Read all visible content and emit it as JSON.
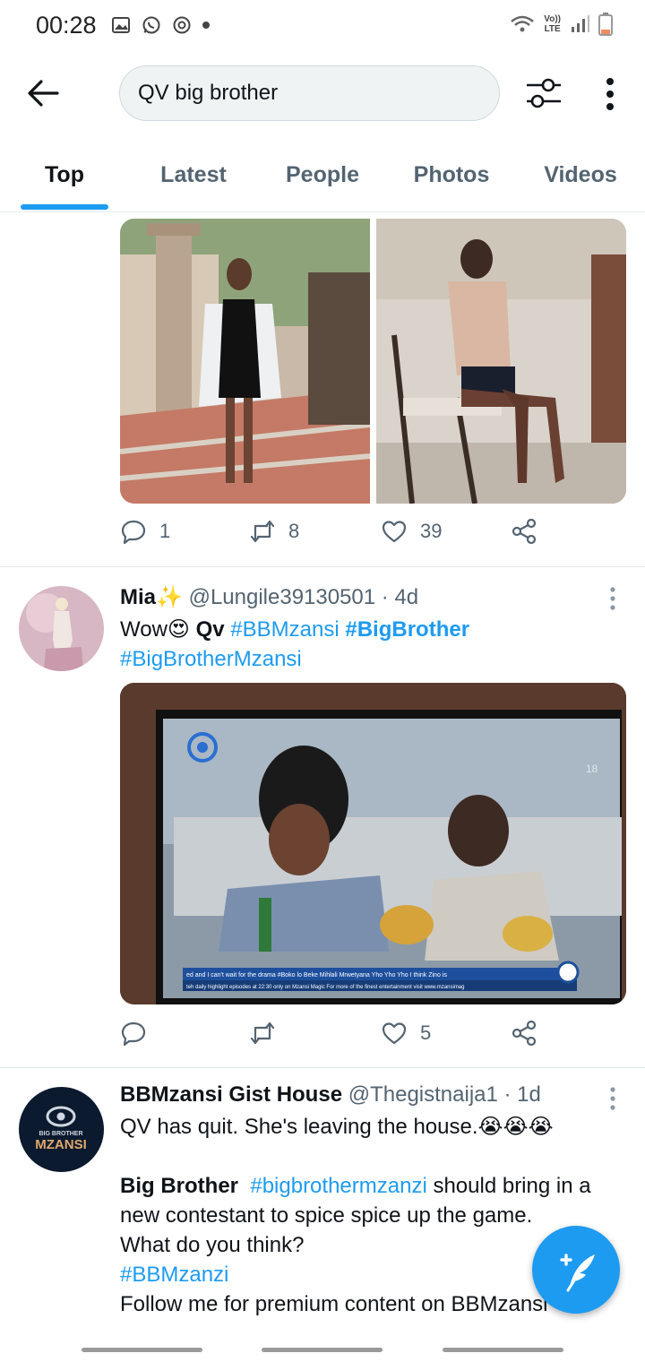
{
  "status_bar": {
    "time": "00:28",
    "net_line1": "Vo))",
    "net_line2": "LTE"
  },
  "search": {
    "query": "QV big brother"
  },
  "tabs": [
    {
      "label": "Top",
      "active": true
    },
    {
      "label": "Latest",
      "active": false
    },
    {
      "label": "People",
      "active": false
    },
    {
      "label": "Photos",
      "active": false
    },
    {
      "label": "Videos",
      "active": false
    }
  ],
  "tweet1": {
    "reply_count": "1",
    "retweet_count": "8",
    "like_count": "39"
  },
  "tweet2": {
    "name": "Mia",
    "handle": "@Lungile39130501",
    "time": "· 4d",
    "text_prefix": "Wow",
    "text_mid": " Qv ",
    "tag1": "#BBMzansi",
    "tag2": "#BigBrother",
    "tag3": "#BigBrotherMzansi",
    "reply_count": "",
    "retweet_count": "",
    "like_count": "5",
    "tv_ticker_line1": "ed and I can't wait for the drama #Boko lo Beke   Mihlali Mrwetyana  Yho Yho Yho I think Zino is",
    "tv_ticker_line2": "teh daily highlight episodes at 22:30 only on Mzansi Magic  For more of the finest entertainment visit www.mzansimag",
    "tv_channel": "18"
  },
  "tweet3": {
    "name": "BBMzansi Gist House",
    "handle": "@Thegistnaija1",
    "time": "· 1d",
    "line1": "QV has quit. She's leaving the house.",
    "line1_emoji": "😭😭😭",
    "para2_bold": "Big Brother",
    "para2_tag": "#bigbrothermzanzi",
    "para2_rest": " should bring in a",
    "line3": "new contestant to spice spice up the game.",
    "line4": "What do you think?",
    "line5": "#BBMzanzi",
    "line6": "Follow me for premium content on BBMzansi",
    "avatar_text1": "BIG BROTHER",
    "avatar_text2": "MZANSI"
  },
  "colors": {
    "accent": "#1d9bf0",
    "text": "#0f1419",
    "muted": "#536471"
  }
}
